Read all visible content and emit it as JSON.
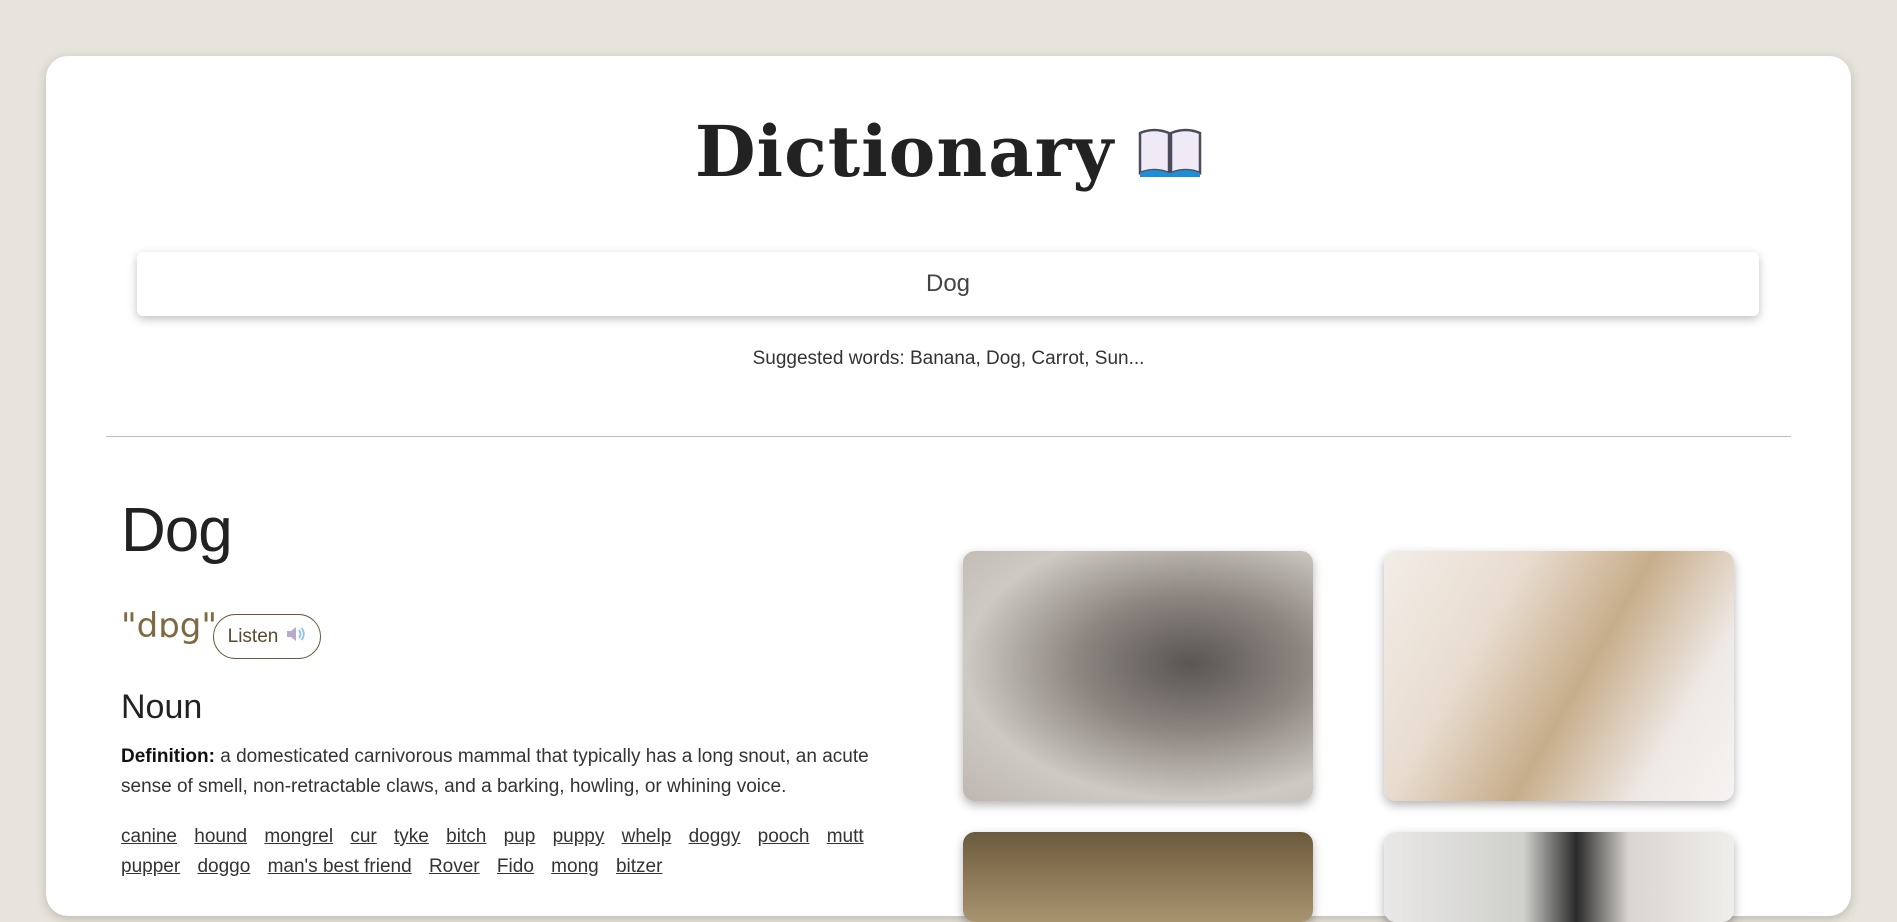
{
  "header": {
    "title": "Dictionary",
    "title_icon": "open-book-icon"
  },
  "search": {
    "value": "Dog",
    "placeholder": ""
  },
  "suggested": {
    "text": "Suggested words: Banana, Dog, Carrot, Sun..."
  },
  "entry": {
    "word": "Dog",
    "phonetic": "\"dɒg\"",
    "listen_label": "Listen",
    "listen_icon": "speaker-icon",
    "part_of_speech": "Noun",
    "definition_label": "Definition:",
    "definition_text": "a domesticated carnivorous mammal that typically has a long snout, an acute sense of smell, non-retractable claws, and a barking, howling, or whining voice.",
    "synonyms": [
      "canine",
      "hound",
      "mongrel",
      "cur",
      "tyke",
      "bitch",
      "pup",
      "puppy",
      "whelp",
      "doggy",
      "pooch",
      "mutt",
      "pupper",
      "doggo",
      "man's best friend",
      "Rover",
      "Fido",
      "mong",
      "bitzer"
    ]
  },
  "photos": [
    "dog-photo",
    "dog-photo",
    "dog-photo",
    "dog-photo"
  ],
  "colors": {
    "background": "#e7e4dd",
    "accent": "#7d6a43",
    "card": "#ffffff"
  }
}
